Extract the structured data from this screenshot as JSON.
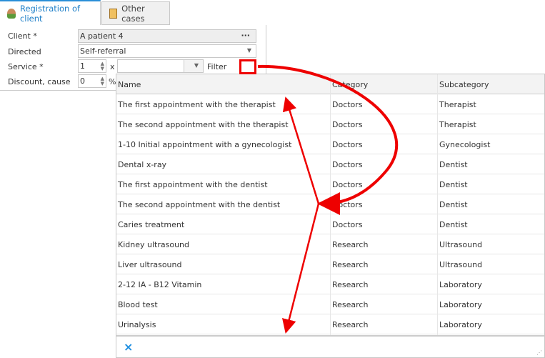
{
  "tabs": [
    {
      "label": "Registration of client",
      "icon": "user-icon",
      "active": true
    },
    {
      "label": "Other cases",
      "icon": "notes-icon",
      "active": false
    }
  ],
  "form": {
    "client": {
      "label": "Client *",
      "value": "A patient 4",
      "button": "···"
    },
    "directed": {
      "label": "Directed",
      "value": "Self-referral"
    },
    "service": {
      "label": "Service *",
      "qty": "1",
      "x": "x",
      "value": "",
      "filter": "Filter"
    },
    "discount": {
      "label": "Discount, cause",
      "value": "0",
      "unit": "%"
    }
  },
  "grid": {
    "columns": [
      "Name",
      "Category",
      "Subcategory"
    ],
    "rows": [
      [
        "The first appointment with the therapist",
        "Doctors",
        "Therapist"
      ],
      [
        "The second appointment with the therapist",
        "Doctors",
        "Therapist"
      ],
      [
        "1-10 Initial appointment with a gynecologist",
        "Doctors",
        "Gynecologist"
      ],
      [
        "Dental x-ray",
        "Doctors",
        "Dentist"
      ],
      [
        "The first appointment with the dentist",
        "Doctors",
        "Dentist"
      ],
      [
        "The second appointment with the dentist",
        "Doctors",
        "Dentist"
      ],
      [
        "Caries treatment",
        "Doctors",
        "Dentist"
      ],
      [
        "Kidney ultrasound",
        "Research",
        "Ultrasound"
      ],
      [
        "Liver ultrasound",
        "Research",
        "Ultrasound"
      ],
      [
        "2-12 IA - B12 Vitamin",
        "Research",
        "Laboratory"
      ],
      [
        "Blood test",
        "Research",
        "Laboratory"
      ],
      [
        "Urinalysis",
        "Research",
        "Laboratory"
      ]
    ],
    "clear_icon": "×"
  },
  "colors": {
    "accent": "#1e7fc8",
    "annotation": "#e00000"
  }
}
